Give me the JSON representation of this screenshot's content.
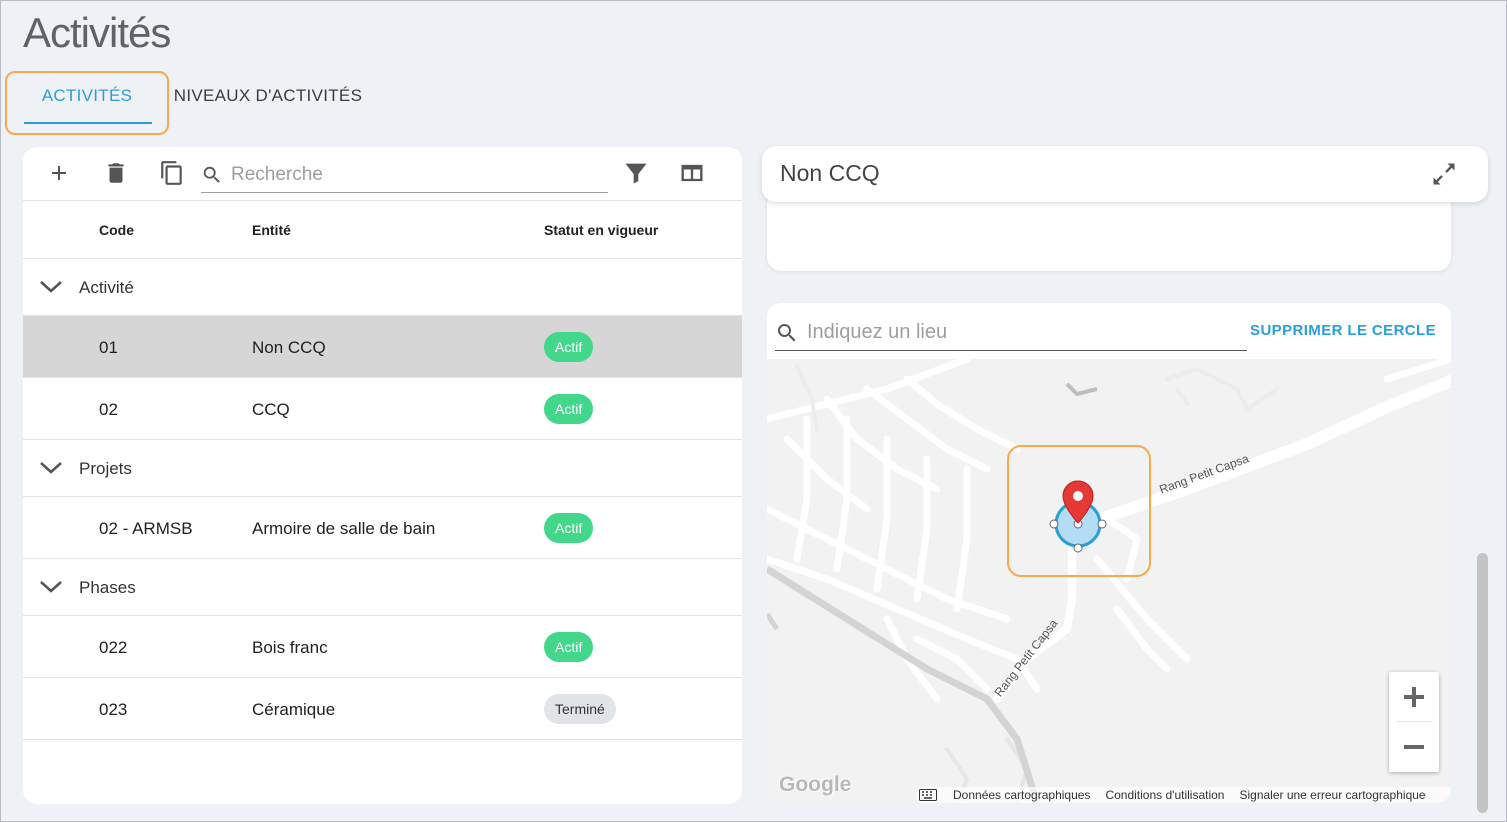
{
  "page": {
    "title": "Activités"
  },
  "tabs": [
    {
      "label": "ACTIVITÉS",
      "active": true
    },
    {
      "label": "NIVEAUX D'ACTIVITÉS",
      "active": false
    }
  ],
  "toolbar": {
    "icons": [
      "add-icon",
      "delete-icon",
      "copy-icon",
      "search-icon",
      "filter-icon",
      "columns-icon"
    ],
    "search_placeholder": "Recherche"
  },
  "table": {
    "headers": {
      "code": "Code",
      "entity": "Entité",
      "status": "Statut en vigueur"
    },
    "groups": [
      {
        "label": "Activité",
        "rows": [
          {
            "code": "01",
            "entity": "Non CCQ",
            "status": "Actif",
            "selected": true
          },
          {
            "code": "02",
            "entity": "CCQ",
            "status": "Actif"
          }
        ]
      },
      {
        "label": "Projets",
        "rows": [
          {
            "code": "02 - ARMSB",
            "entity": "Armoire de salle de bain",
            "status": "Actif"
          }
        ]
      },
      {
        "label": "Phases",
        "rows": [
          {
            "code": "022",
            "entity": "Bois franc",
            "status": "Actif"
          },
          {
            "code": "023",
            "entity": "Céramique",
            "status": "Terminé"
          }
        ]
      }
    ]
  },
  "detail": {
    "title": "Non CCQ"
  },
  "map": {
    "search_placeholder": "Indiquez un lieu",
    "delete_circle_label": "SUPPRIMER LE CERCLE",
    "road_labels": [
      "Rang Petit Capsa",
      "Rang Petit Capsa"
    ],
    "logo": "Google",
    "attribution": [
      "Données cartographiques",
      "Conditions d'utilisation",
      "Signaler une erreur cartographique"
    ]
  },
  "colors": {
    "accent": "#2a9fd6",
    "active_badge": "#42d78a",
    "highlight": "#f7a94b",
    "marker": "#e53935"
  }
}
